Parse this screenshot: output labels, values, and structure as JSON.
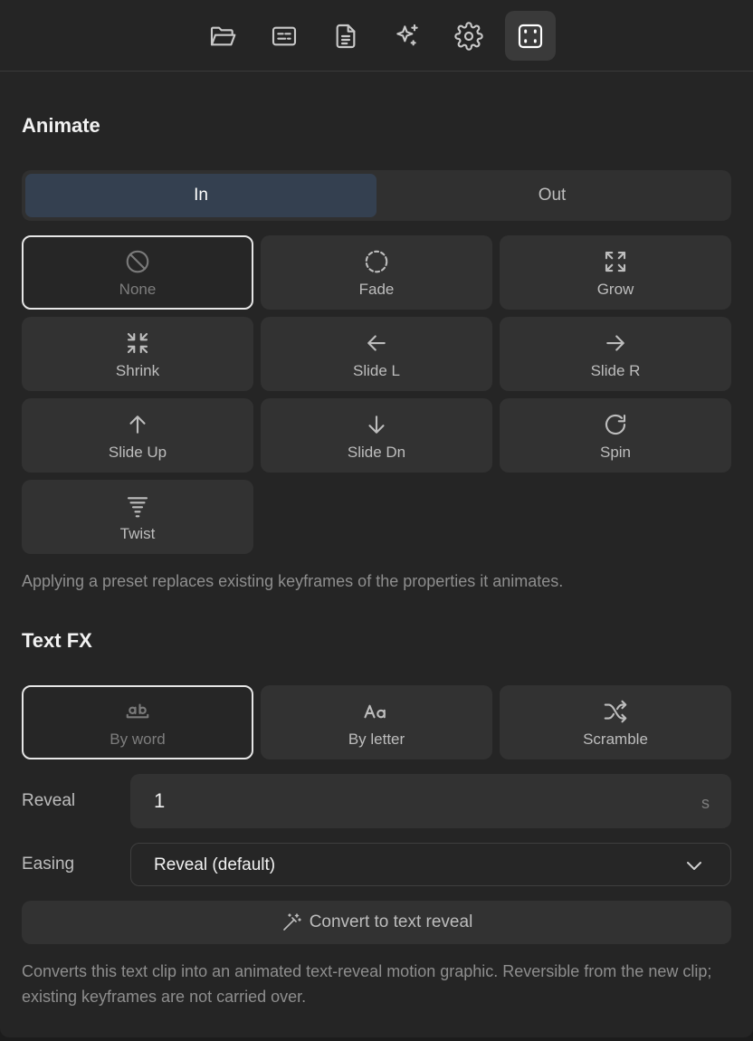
{
  "toolbar": {
    "items": [
      {
        "icon": "folder-icon"
      },
      {
        "icon": "captions-icon"
      },
      {
        "icon": "document-icon"
      },
      {
        "icon": "sparkles-icon"
      },
      {
        "icon": "gear-icon"
      },
      {
        "icon": "frame-icon",
        "active": true
      }
    ]
  },
  "animate": {
    "title": "Animate",
    "tabs": {
      "in": "In",
      "out": "Out",
      "selected": "In"
    },
    "presets": [
      {
        "label": "None",
        "icon": "none-icon",
        "selected": true
      },
      {
        "label": "Fade",
        "icon": "dashed-circle-icon"
      },
      {
        "label": "Grow",
        "icon": "expand-icon"
      },
      {
        "label": "Shrink",
        "icon": "shrink-icon"
      },
      {
        "label": "Slide L",
        "icon": "arrow-left-icon"
      },
      {
        "label": "Slide R",
        "icon": "arrow-right-icon"
      },
      {
        "label": "Slide Up",
        "icon": "arrow-up-icon"
      },
      {
        "label": "Slide Dn",
        "icon": "arrow-down-icon"
      },
      {
        "label": "Spin",
        "icon": "rotate-icon"
      },
      {
        "label": "Twist",
        "icon": "twist-icon"
      }
    ],
    "note": "Applying a preset replaces existing keyframes of the properties it animates."
  },
  "textfx": {
    "title": "Text FX",
    "presets": [
      {
        "label": "By word",
        "icon": "by-word-icon",
        "selected": true
      },
      {
        "label": "By letter",
        "icon": "by-letter-icon"
      },
      {
        "label": "Scramble",
        "icon": "shuffle-icon"
      }
    ],
    "reveal_label": "Reveal",
    "reveal_value": "1",
    "reveal_unit": "s",
    "easing_label": "Easing",
    "easing_value": "Reveal (default)",
    "convert_label": "Convert to text reveal",
    "note": "Converts this text clip into an animated text-reveal motion graphic. Reversible from the new clip; existing keyframes are not carried over."
  },
  "colors": {
    "panel_bg": "#252525",
    "tile_bg": "#323232",
    "tab_active_bg": "#344050",
    "selected_border": "#e6e6e6"
  }
}
